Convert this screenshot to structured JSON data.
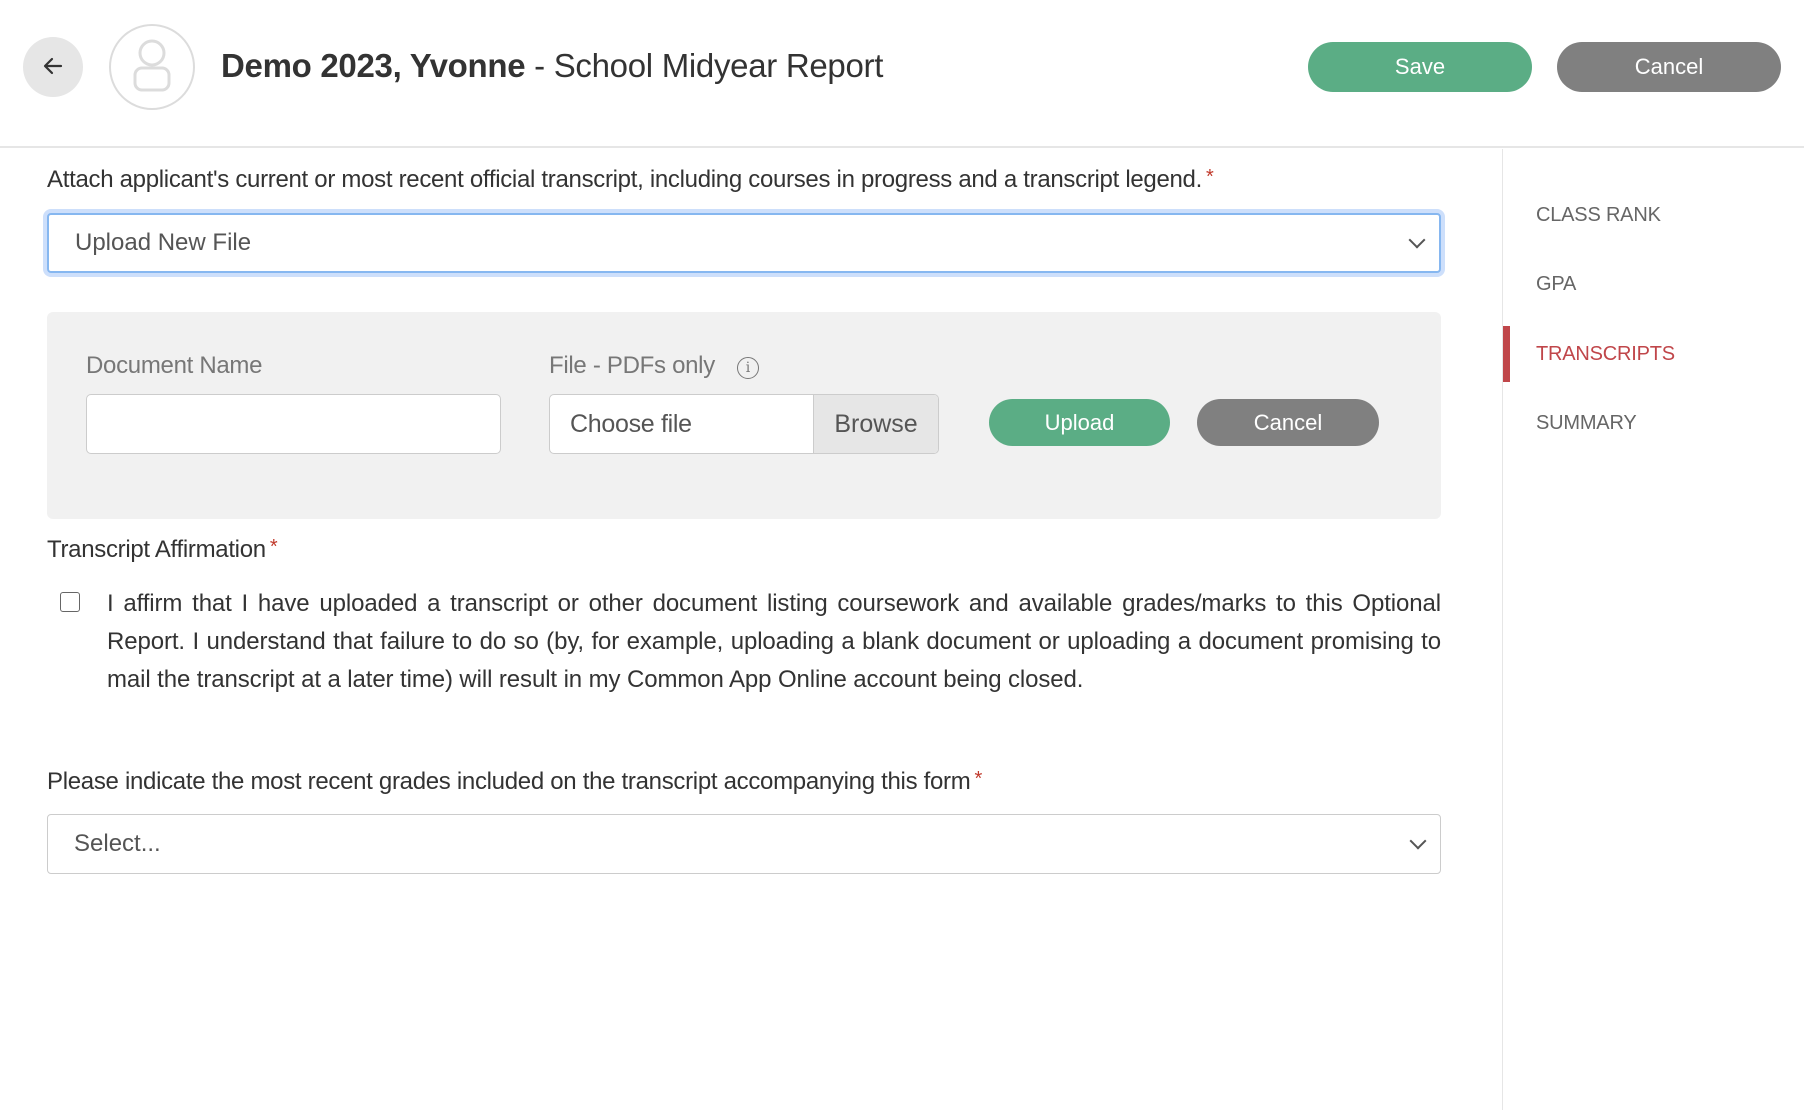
{
  "header": {
    "back_icon": "arrow-left-icon",
    "avatar_icon": "user-icon",
    "student_name": "Demo 2023, Yvonne",
    "separator": " - ",
    "report_title": "School Midyear Report",
    "save_label": "Save",
    "cancel_label": "Cancel"
  },
  "sidebar": {
    "items": [
      {
        "label": "CLASS RANK",
        "active": false
      },
      {
        "label": "GPA",
        "active": false
      },
      {
        "label": "TRANSCRIPTS",
        "active": true
      },
      {
        "label": "SUMMARY",
        "active": false
      }
    ],
    "active_color": "#c0464a"
  },
  "transcript": {
    "label": "Attach applicant's current or most recent official transcript, including courses in progress and a transcript legend.",
    "required_mark": "*",
    "select_value": "Upload New File"
  },
  "upload_panel": {
    "doc_name_label": "Document Name",
    "doc_name_value": "",
    "file_label": "File - PDFs only",
    "info_icon": "info-icon",
    "file_placeholder": "Choose file",
    "browse_label": "Browse",
    "upload_label": "Upload",
    "cancel_label": "Cancel"
  },
  "affirmation": {
    "label": "Transcript Affirmation",
    "required_mark": "*",
    "checked": false,
    "text": "I affirm that I have uploaded a transcript or other document listing coursework and available grades/marks to this Optional Report. I understand that failure to do so (by, for example, uploading a blank document or uploading a document promising to mail the transcript at a later time) will result in my Common App Online account being closed."
  },
  "grades": {
    "label": "Please indicate the most recent grades included on the transcript accompanying this form",
    "required_mark": "*",
    "select_placeholder": "Select..."
  },
  "colors": {
    "primary_green": "#5bad85",
    "neutral_gray": "#808080",
    "required_red": "#c0392b",
    "focus_blue": "#86b7f0"
  }
}
